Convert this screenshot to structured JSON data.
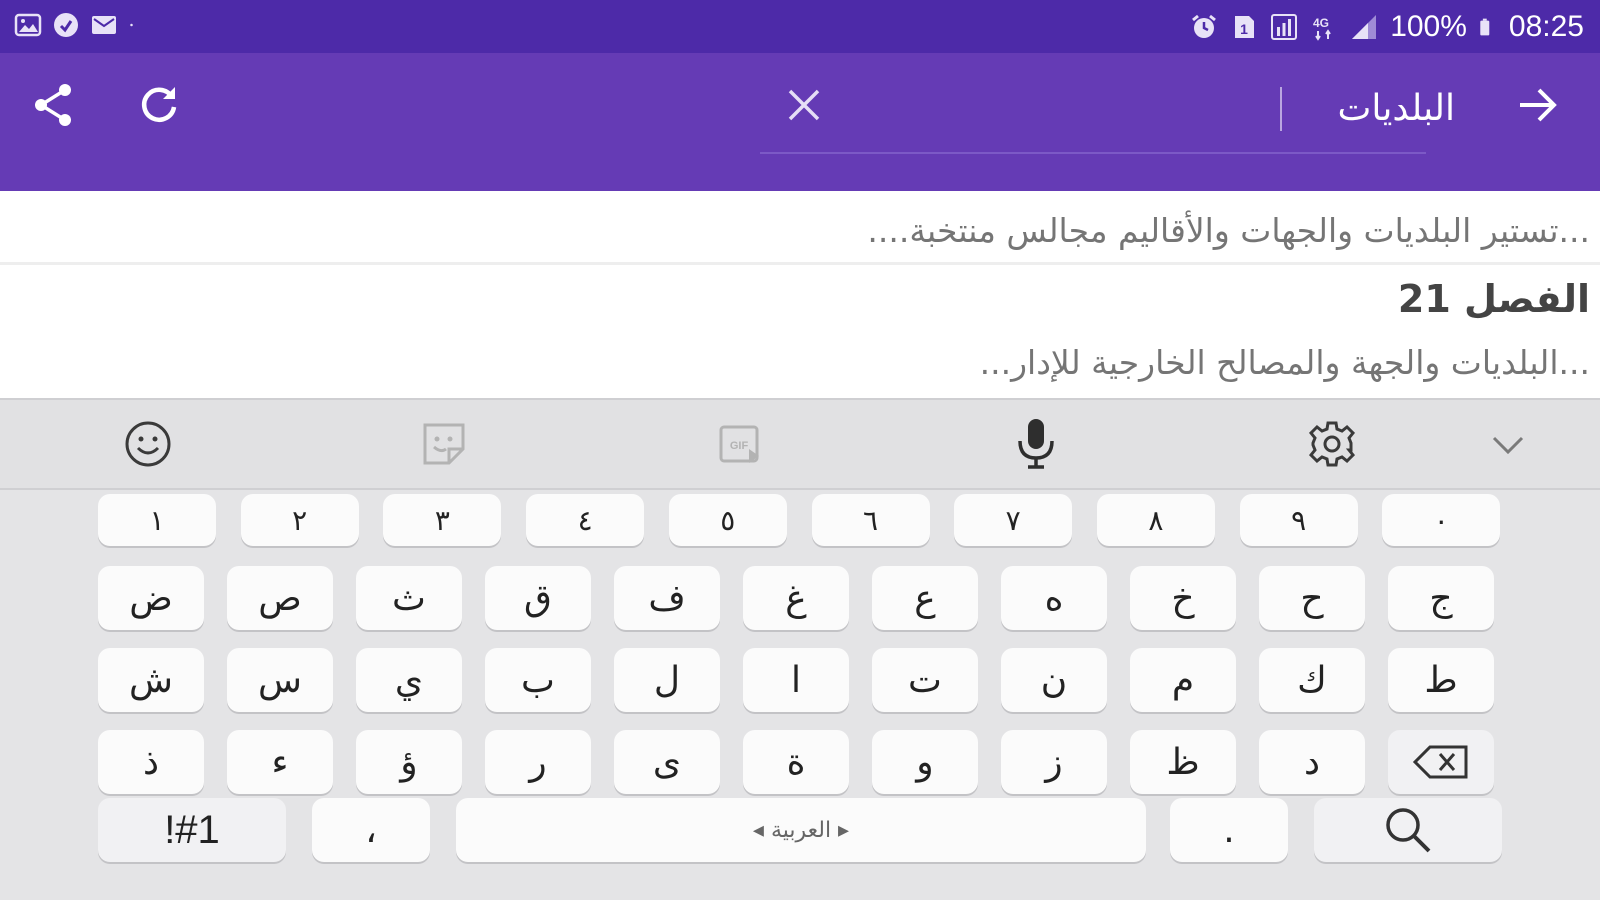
{
  "status_bar": {
    "battery": "100%",
    "time": "08:25",
    "icons": [
      "gallery-icon",
      "sync-icon",
      "mail-icon",
      "alarm-icon",
      "sim-icon",
      "data-icon",
      "network-4g-icon",
      "signal-icon",
      "battery-icon"
    ]
  },
  "app_bar": {
    "search_value": "البلديات",
    "icons": [
      "share-icon",
      "refresh-icon",
      "close-icon",
      "arrow-forward-icon"
    ]
  },
  "results": [
    {
      "snippet": "...تستير البلديات والجهات والأقاليم مجالس منتخبة...."
    },
    {
      "title": "الفصل 21",
      "snippet": "...البلديات والجهة والمصالح الخارجية للإدار..."
    }
  ],
  "keyboard": {
    "toolbar": [
      "emoji-icon",
      "sticker-icon",
      "gif-icon",
      "microphone-icon",
      "settings-icon",
      "chevron-down-icon"
    ],
    "number_row": [
      "١",
      "٢",
      "٣",
      "٤",
      "٥",
      "٦",
      "٧",
      "٨",
      "٩",
      "٠"
    ],
    "row1": [
      "ض",
      "ص",
      "ث",
      "ق",
      "ف",
      "غ",
      "ع",
      "ه",
      "خ",
      "ح",
      "ج"
    ],
    "row2": [
      "ش",
      "س",
      "ي",
      "ب",
      "ل",
      "ا",
      "ت",
      "ن",
      "م",
      "ك",
      "ط"
    ],
    "row3": [
      "ذ",
      "ء",
      "ؤ",
      "ر",
      "ى",
      "ة",
      "و",
      "ز",
      "ظ",
      "د"
    ],
    "symbols_label": "!#1",
    "comma": "،",
    "space_label": "◂ العربية ▸",
    "period": "."
  },
  "colors": {
    "status_bar": "#4d2aa8",
    "app_bar": "#653bb5",
    "keyboard_bg": "#e4e4e6",
    "key_bg": "#fbfbfb"
  }
}
